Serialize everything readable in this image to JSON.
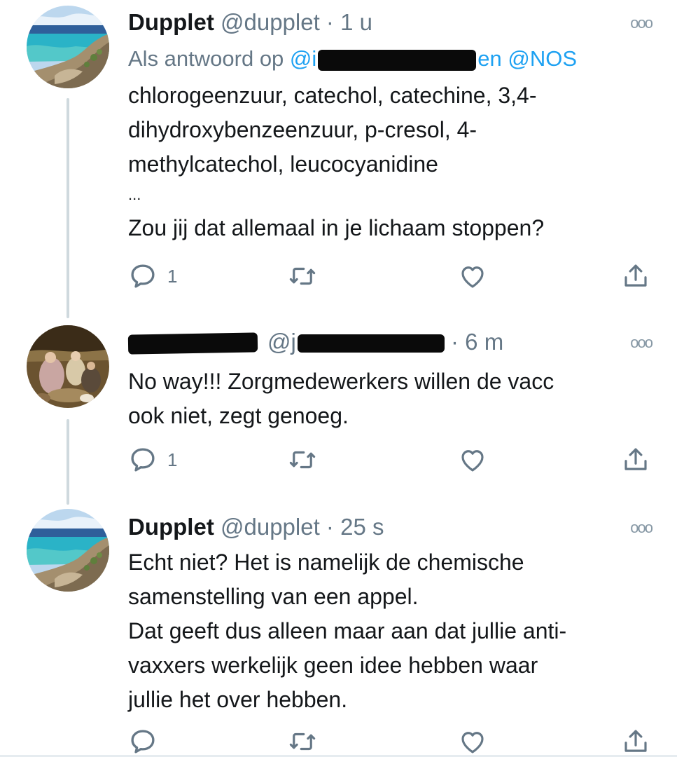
{
  "tweets": [
    {
      "display_name": "Dupplet",
      "handle": "@dupplet",
      "separator": " · ",
      "time": "1 u",
      "reply_prefix": "Als antwoord op ",
      "reply_mention_start": "@i",
      "reply_mention_end": "en @NOS",
      "lines": [
        "chlorogeenzuur, catechol, catechine, 3,4-",
        "dihydroxybenzeenzuur, p-cresol, 4-",
        "methylcatechol, leucocyanidine",
        "...",
        "Zou jij dat allemaal in je lichaam stoppen?"
      ],
      "reply_count": "1",
      "avatar_icon": "beach-landscape-avatar"
    },
    {
      "handle_visible": "@j",
      "separator": " · ",
      "time": "6 m",
      "lines": [
        "No way!!! Zorgmedewerkers willen de vacc",
        "ook niet, zegt genoeg."
      ],
      "reply_count": "1",
      "avatar_icon": "painting-avatar"
    },
    {
      "display_name": "Dupplet",
      "handle": "@dupplet",
      "separator": " · ",
      "time": "25 s",
      "lines": [
        "Echt niet? Het is namelijk de chemische",
        "samenstelling van een appel.",
        "Dat geeft dus alleen maar aan dat jullie anti-",
        "vaxxers werkelijk geen idee hebben waar",
        "jullie het over hebben."
      ],
      "avatar_icon": "beach-landscape-avatar"
    }
  ],
  "more_icon": "ooo",
  "icons": [
    "reply-icon",
    "retweet-icon",
    "like-icon",
    "share-icon",
    "more-options-icon"
  ],
  "colors": {
    "text": "#14171a",
    "muted": "#657786",
    "link": "#1da1f2",
    "thread_line": "#cfd9de",
    "redaction": "#0a0a0a"
  }
}
